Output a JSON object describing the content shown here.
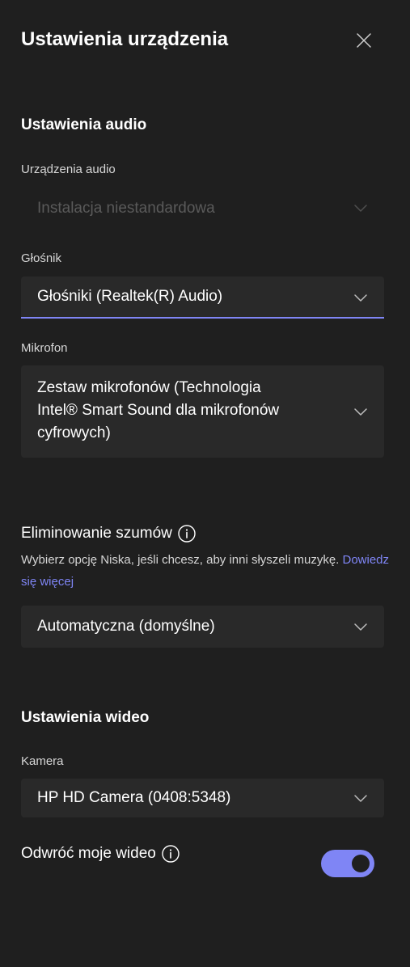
{
  "header": {
    "title": "Ustawienia urządzenia",
    "close_icon": "close-icon"
  },
  "audio": {
    "section_title": "Ustawienia audio",
    "devices": {
      "label": "Urządzenia audio",
      "value": "Instalacja niestandardowa",
      "disabled": true
    },
    "speaker": {
      "label": "Głośnik",
      "value": "Głośniki (Realtek(R) Audio)"
    },
    "microphone": {
      "label": "Mikrofon",
      "value_lines": [
        "Zestaw mikrofonów (Technologia",
        "Intel® Smart Sound dla mikrofonów",
        "cyfrowych)"
      ]
    },
    "noise": {
      "label": "Eliminowanie szumów",
      "description": "Wybierz opcję Niska, jeśli chcesz, aby inni słyszeli muzykę.",
      "link": "Dowiedz się więcej",
      "value": "Automatyczna (domyślne)"
    }
  },
  "video": {
    "section_title": "Ustawienia wideo",
    "camera": {
      "label": "Kamera",
      "value": "HP HD Camera (0408:5348)"
    },
    "mirror": {
      "label": "Odwróć moje wideo",
      "enabled": true
    }
  },
  "colors": {
    "background": "#1f1f1f",
    "dropdown": "#292929",
    "accent": "#7f85f5"
  }
}
